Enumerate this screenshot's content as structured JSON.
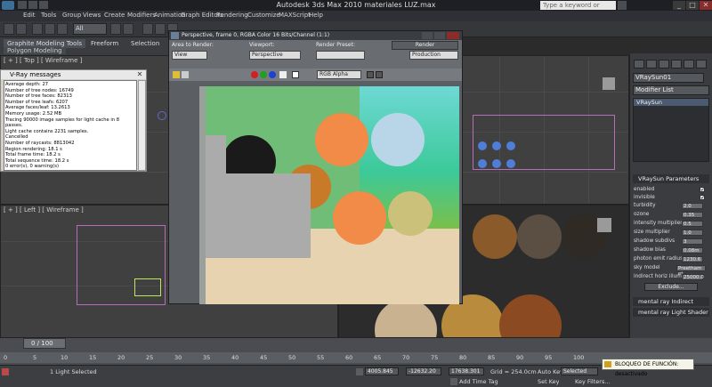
{
  "titlebar": {
    "title": "Autodesk 3ds Max 2010    materiales LUZ.max",
    "search_placeholder": "Type a keyword or phrase",
    "btn_minimize": "_",
    "btn_maximize": "□",
    "btn_close": "✕"
  },
  "menubar": {
    "items": [
      "Edit",
      "Tools",
      "Group",
      "Views",
      "Create",
      "Modifiers",
      "Animation",
      "Graph Editors",
      "Rendering",
      "Customize",
      "MAXScript",
      "Help"
    ]
  },
  "toolbar": {
    "selection_filter": "All"
  },
  "ribbon": {
    "tabs": [
      "Graphite Modeling Tools",
      "Freeform",
      "Selection"
    ],
    "panel": "Polygon Modeling"
  },
  "viewports": {
    "top_label": "[ + ] [ Top ] [ Wireframe ]",
    "left_label": "[ + ] [ Left ] [ Wireframe ]"
  },
  "vray_messages": {
    "title": "V-Ray messages",
    "close": "✕",
    "lines": [
      "Average depth: 27",
      "Number of tree nodes: 16749",
      "Number of tree faces: 82313",
      "Number of tree leafs: 6207",
      "Average faces/leaf: 13.2613",
      "Memory usage: 2.52 MB",
      "Tracing 90000 image samples for light cache in 8 passes.",
      "Light cache contains 2231 samples.",
      "Cancelled",
      "Number of raycasts: 8813042",
      "Region rendering: 18.1 s",
      "Total frame time: 18.2 s",
      "Total sequence time: 18.2 s",
      "0 error(s), 0 warning(s)",
      "======================================"
    ]
  },
  "frame_buffer": {
    "title": "Perspective, frame 0, RGBA Color 16 Bits/Channel (1:1)",
    "area_label": "Area to Render:",
    "area_value": "View",
    "viewport_label": "Viewport:",
    "viewport_value": "Perspective",
    "preset_label": "Render Preset:",
    "preset_value": "",
    "render_button": "Render",
    "mode_value": "Production",
    "channel_value": "RGB Alpha"
  },
  "command_panel": {
    "object_name": "VRaySun01",
    "modifier_list": "Modifier List",
    "stack_item": "VRaySun",
    "rollout_title": "VRaySun Parameters",
    "params": [
      {
        "label": "enabled",
        "value": "✓"
      },
      {
        "label": "invisible",
        "value": "✓"
      },
      {
        "label": "turbidity",
        "value": "2.0"
      },
      {
        "label": "ozone",
        "value": "0.35"
      },
      {
        "label": "intensity multiplier",
        "value": "0.5"
      },
      {
        "label": "size multiplier",
        "value": "1.0"
      },
      {
        "label": "shadow subdivs",
        "value": "3"
      },
      {
        "label": "shadow bias",
        "value": "0.08m"
      },
      {
        "label": "photon emit radius",
        "value": "1230.6"
      },
      {
        "label": "sky model",
        "value": "Preetham et"
      },
      {
        "label": "indirect horiz illum",
        "value": "25000.0"
      }
    ],
    "exclude_button": "Exclude...",
    "rollout2": "mental ray Indirect Illumination",
    "rollout3": "mental ray Light Shader"
  },
  "timeline": {
    "frame": "0 / 100",
    "ticks": [
      "0",
      "5",
      "10",
      "15",
      "20",
      "25",
      "30",
      "35",
      "40",
      "45",
      "50",
      "55",
      "60",
      "65",
      "70",
      "75",
      "80",
      "85",
      "90",
      "95",
      "100"
    ]
  },
  "statusbar": {
    "selection": "1 Light Selected",
    "x_value": "4005.845",
    "y_value": "-12632.20",
    "z_value": "17638.301",
    "grid": "Grid = 254.0cm",
    "auto_key": "Auto Key",
    "set_key": "Set Key",
    "selected": "Selected",
    "key_filters": "Key Filters...",
    "add_time_tag": "Add Time Tag",
    "tooltip": "BLOQUEO DE FUNCIÓN: desactivado"
  },
  "colors": {
    "accent": "#3c6e9a",
    "window_bg": "#2b2b2b"
  }
}
